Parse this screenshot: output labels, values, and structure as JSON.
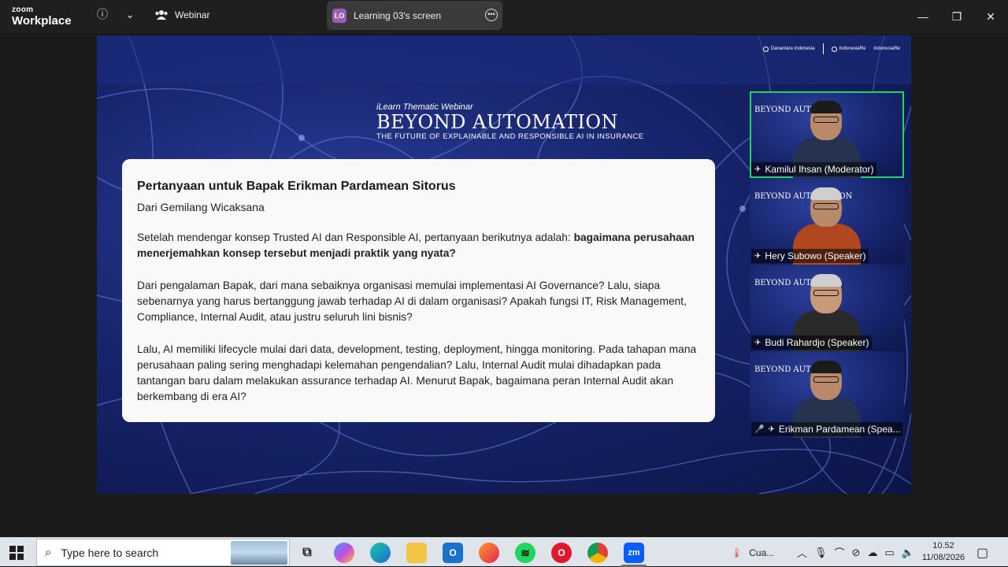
{
  "titlebar": {
    "logo_small": "zoom",
    "logo_big": "Workplace",
    "webinar_label": "Webinar",
    "share_initials": "LO",
    "share_label": "Learning 03's screen"
  },
  "slide": {
    "header_sub": "iLearn Thematic Webinar",
    "header_main": "BEYOND AUTOMATION",
    "header_tag": "THE FUTURE OF EXPLAINABLE AND RESPONSIBLE AI IN INSURANCE",
    "logo1": "Danantara Indonesia",
    "logo2": "IndonesiaRe",
    "logo3": "IndonesiaRe"
  },
  "card": {
    "title": "Pertanyaan untuk Bapak Erikman Pardamean Sitorus",
    "from": "Dari Gemilang Wicaksana",
    "p1_normal": "Setelah mendengar konsep Trusted AI dan Responsible AI, pertanyaan berikutnya adalah: ",
    "p1_bold": "bagaimana perusahaan menerjemahkan konsep tersebut menjadi praktik yang nyata?",
    "p2": "Dari pengalaman Bapak, dari mana sebaiknya organisasi memulai implementasi AI Governance? Lalu, siapa sebenarnya yang harus bertanggung jawab terhadap AI di dalam organisasi? Apakah fungsi IT, Risk Management, Compliance, Internal Audit, atau justru seluruh lini bisnis?",
    "p3": "Lalu, AI memiliki lifecycle mulai dari data, development, testing, deployment, hingga monitoring. Pada tahapan mana perusahaan paling sering menghadapi kelemahan pengendalian? Lalu, Internal Audit mulai dihadapkan pada tantangan baru dalam melakukan assurance terhadap AI. Menurut Bapak, bagaimana peran Internal Audit akan berkembang di era AI?"
  },
  "participants": [
    {
      "name": "Kamilul Ihsan (Moderator)",
      "tile_title": "BEYOND AUTOM",
      "active": true
    },
    {
      "name": "Hery Subowo (Speaker)",
      "tile_title": "BEYOND AUTOMATION",
      "active": false
    },
    {
      "name": "Budi Rahardjo (Speaker)",
      "tile_title": "BEYOND AUTOMATI",
      "active": false
    },
    {
      "name": "Erikman Pardamean (Spea...",
      "tile_title": "BEYOND AUTOM",
      "active": false
    }
  ],
  "taskbar": {
    "search_placeholder": "Type here to search",
    "weather": "Cua...",
    "time": "10.52",
    "date": "11/08/2026",
    "zoom_app": "zm"
  }
}
